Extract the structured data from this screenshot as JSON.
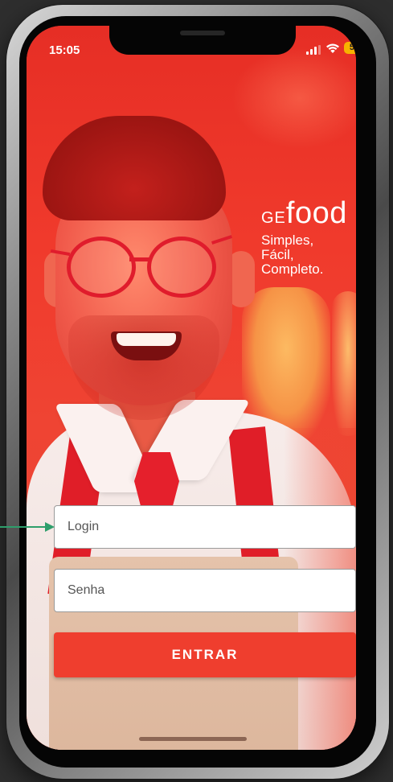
{
  "status_bar": {
    "time": "15:05",
    "battery": "57"
  },
  "brand": {
    "logo_prefix": "GE",
    "logo_main": "food",
    "tagline": [
      "Simples,",
      "Fácil,",
      "Completo."
    ]
  },
  "form": {
    "login_placeholder": "Login",
    "password_placeholder": "Senha",
    "submit_label": "ENTRAR"
  },
  "colors": {
    "accent": "#ef3e2e",
    "battery": "#f7b200",
    "arrow": "#2e9e6b"
  },
  "icons": [
    "signal-icon",
    "wifi-icon",
    "battery-icon",
    "arrow-icon"
  ]
}
